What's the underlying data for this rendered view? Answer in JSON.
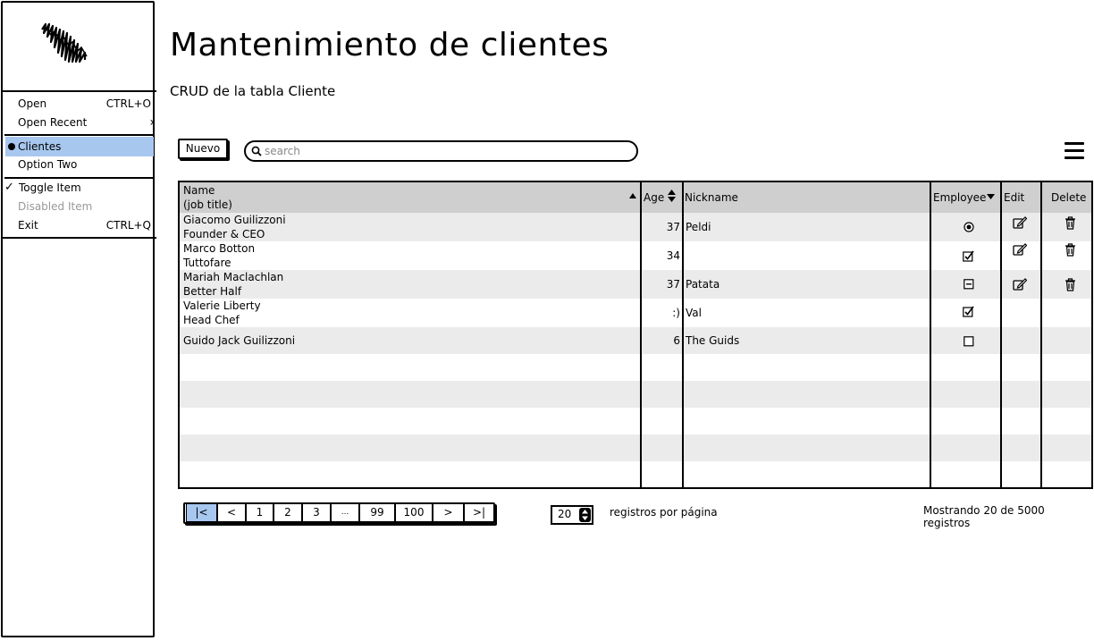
{
  "header": {
    "title": "Mantenimiento de clientes",
    "subtitle": "CRUD de la tabla Cliente"
  },
  "menu": {
    "items": [
      {
        "label": "Open",
        "shortcut": "CTRL+O"
      },
      {
        "label": "Open Recent",
        "submenu_arrow": "›"
      },
      {
        "label": "Clientes",
        "selected": true
      },
      {
        "label": "Option Two"
      },
      {
        "label": "Toggle Item",
        "checked": true
      },
      {
        "label": "Disabled Item",
        "disabled": true
      },
      {
        "label": "Exit",
        "shortcut": "CTRL+Q"
      }
    ],
    "check_glyph": "✓"
  },
  "toolbar": {
    "new_label": "Nuevo",
    "search_placeholder": "search"
  },
  "table": {
    "columns": {
      "name": "Name",
      "job": "(job title)",
      "age": "Age",
      "nickname": "Nickname",
      "employee": "Employee",
      "edit": "Edit",
      "delete": "Delete"
    },
    "rows": [
      {
        "name": "Giacomo Guilizzoni",
        "job": "Founder & CEO",
        "age": "37",
        "nickname": "Peldi",
        "employee": "radio",
        "edit": true,
        "delete": true
      },
      {
        "name": "Marco Botton",
        "job": "Tuttofare",
        "age": "34",
        "nickname": "",
        "employee": "checked",
        "edit": true,
        "delete": true
      },
      {
        "name": "Mariah Maclachlan",
        "job": "Better Half",
        "age": "37",
        "nickname": "Patata",
        "employee": "indeterminate",
        "edit": true,
        "delete": true
      },
      {
        "name": "Valerie Liberty",
        "job": "Head Chef",
        "age": ":)",
        "nickname": "Val",
        "employee": "checked",
        "edit": false,
        "delete": false
      },
      {
        "name": "Guido Jack Guilizzoni",
        "job": "",
        "age": "6",
        "nickname": "The Guids",
        "employee": "unchecked",
        "edit": false,
        "delete": false
      }
    ]
  },
  "pagination": {
    "buttons": [
      "|<",
      "<",
      "1",
      "2",
      "3",
      "...",
      "99",
      "100",
      ">",
      ">|"
    ],
    "active_index": 0,
    "per_page": "20",
    "per_page_label": "registros por página",
    "status": "Mostrando 20 de 5000 registros"
  },
  "colors": {
    "selection": "#a7c7ef",
    "header_bg": "#cfcfcf",
    "stripe": "#ebebeb"
  },
  "icons": {
    "logo": "scribble-logo",
    "search": "search-icon",
    "menu": "hamburger-icon",
    "edit": "edit-icon",
    "delete": "trash-icon"
  }
}
